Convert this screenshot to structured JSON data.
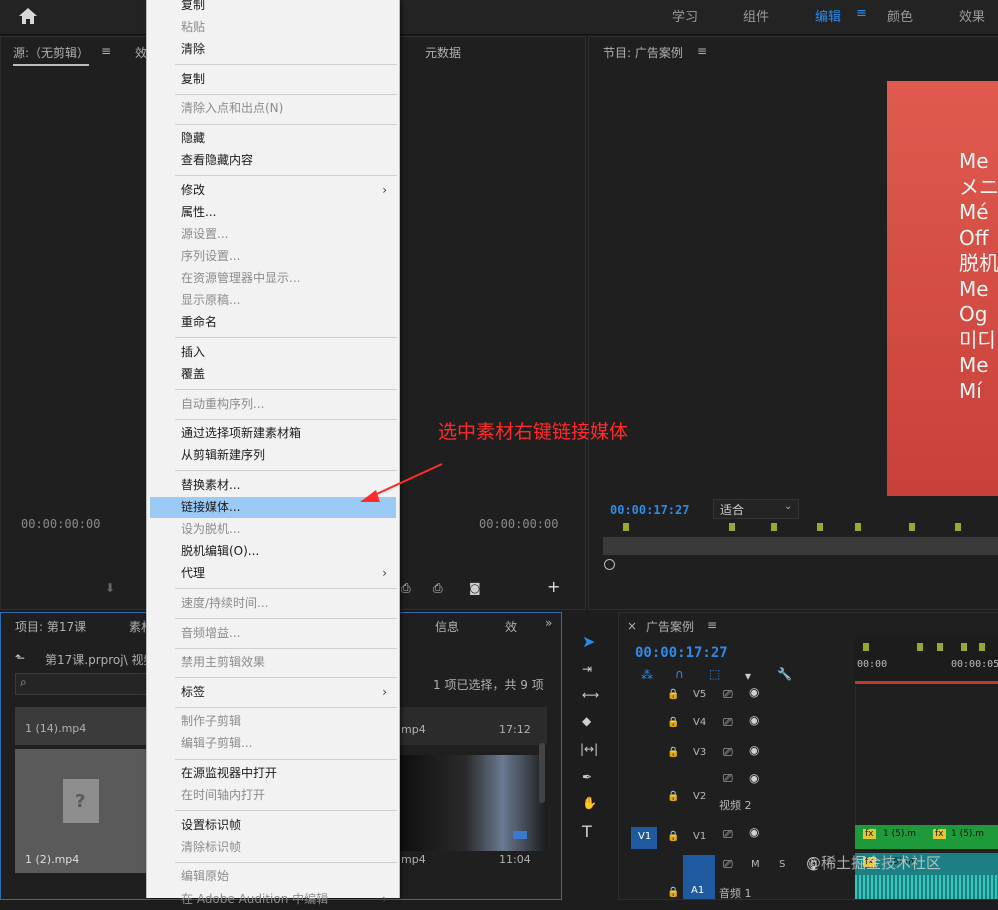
{
  "workspaces": [
    "学习",
    "组件",
    "编辑",
    "颜色",
    "效果"
  ],
  "source_panel": {
    "title": "源:（无剪辑）",
    "tab2": "效",
    "tab3": "元数据",
    "timecode": "00:00:00:00",
    "timecode_right": "00:00:00:00"
  },
  "program_panel": {
    "title": "节目: 广告案例",
    "timecode": "00:00:17:27",
    "fit": "适合",
    "video_lines": [
      "Me",
      "メニ",
      "Mé",
      "Off",
      "脱机",
      "Me",
      "Og",
      "미디",
      "Me",
      "Mí"
    ]
  },
  "project_panel": {
    "tab": "项目: 第17课",
    "tab2": "素材",
    "info_tab": "信息",
    "effects_tab": "效",
    "path": "第17课.prproj\\ 视频",
    "selection_info": "1 项已选择，共 9 项",
    "clips": [
      {
        "name": "1 (14).mp4"
      },
      {
        "name": "1 (2).mp4"
      },
      {
        "name": "mp4",
        "duration": "17:12"
      },
      {
        "name": "mp4",
        "duration": "11:04"
      }
    ]
  },
  "timeline": {
    "title": "广告案例",
    "timecode": "00:00:17:27",
    "ruler": [
      "00:00",
      "00:00:05:0"
    ],
    "tracks": [
      {
        "id": "V5"
      },
      {
        "id": "V4"
      },
      {
        "id": "V3"
      },
      {
        "id": "V2",
        "name": "视频 2"
      },
      {
        "id": "V1",
        "src": "V1"
      },
      {
        "id": "A1",
        "name": "音频 1",
        "m": "M",
        "s": "S"
      }
    ],
    "clip_labels": [
      "1 (5).m",
      "1 (5).m",
      "1 (5) m"
    ]
  },
  "context_menu": {
    "items": [
      {
        "label": "复制",
        "type": "item"
      },
      {
        "label": "粘贴",
        "type": "disabled"
      },
      {
        "label": "清除",
        "type": "item"
      },
      {
        "type": "sep"
      },
      {
        "label": "复制",
        "type": "item"
      },
      {
        "type": "sep"
      },
      {
        "label": "清除入点和出点(N)",
        "type": "disabled"
      },
      {
        "type": "sep"
      },
      {
        "label": "隐藏",
        "type": "item"
      },
      {
        "label": "查看隐藏内容",
        "type": "item"
      },
      {
        "type": "sep"
      },
      {
        "label": "修改",
        "type": "item",
        "submenu": true
      },
      {
        "label": "属性...",
        "type": "item"
      },
      {
        "label": "源设置...",
        "type": "disabled"
      },
      {
        "label": "序列设置...",
        "type": "disabled"
      },
      {
        "label": "在资源管理器中显示...",
        "type": "disabled"
      },
      {
        "label": "显示原稿...",
        "type": "disabled"
      },
      {
        "label": "重命名",
        "type": "item"
      },
      {
        "type": "sep"
      },
      {
        "label": "插入",
        "type": "item"
      },
      {
        "label": "覆盖",
        "type": "item"
      },
      {
        "type": "sep"
      },
      {
        "label": "自动重构序列...",
        "type": "disabled"
      },
      {
        "type": "sep"
      },
      {
        "label": "通过选择项新建素材箱",
        "type": "item"
      },
      {
        "label": "从剪辑新建序列",
        "type": "item"
      },
      {
        "type": "sep"
      },
      {
        "label": "替换素材...",
        "type": "item"
      },
      {
        "label": "链接媒体...",
        "type": "highlight"
      },
      {
        "label": "设为脱机...",
        "type": "disabled"
      },
      {
        "label": "脱机编辑(O)...",
        "type": "item"
      },
      {
        "label": "代理",
        "type": "item",
        "submenu": true
      },
      {
        "type": "sep"
      },
      {
        "label": "速度/持续时间...",
        "type": "disabled"
      },
      {
        "type": "sep"
      },
      {
        "label": "音频增益...",
        "type": "disabled"
      },
      {
        "type": "sep"
      },
      {
        "label": "禁用主剪辑效果",
        "type": "disabled"
      },
      {
        "type": "sep"
      },
      {
        "label": "标签",
        "type": "item",
        "submenu": true
      },
      {
        "type": "sep"
      },
      {
        "label": "制作子剪辑",
        "type": "disabled"
      },
      {
        "label": "编辑子剪辑...",
        "type": "disabled"
      },
      {
        "type": "sep"
      },
      {
        "label": "在源监视器中打开",
        "type": "item"
      },
      {
        "label": "在时间轴内打开",
        "type": "disabled"
      },
      {
        "type": "sep"
      },
      {
        "label": "设置标识帧",
        "type": "item"
      },
      {
        "label": "清除标识帧",
        "type": "disabled"
      },
      {
        "type": "sep"
      },
      {
        "label": "编辑原始",
        "type": "disabled"
      },
      {
        "label": "在 Adobe Audition 中编辑",
        "type": "disabled",
        "submenu": true
      }
    ]
  },
  "annotation": "选中素材右键链接媒体",
  "watermark": "@稀土掘金技术社区",
  "colors": {
    "accent": "#2d8ceb",
    "annotation": "#ff2a2a",
    "highlight": "#9ccaf6",
    "clip_green": "#1f9a3a"
  }
}
